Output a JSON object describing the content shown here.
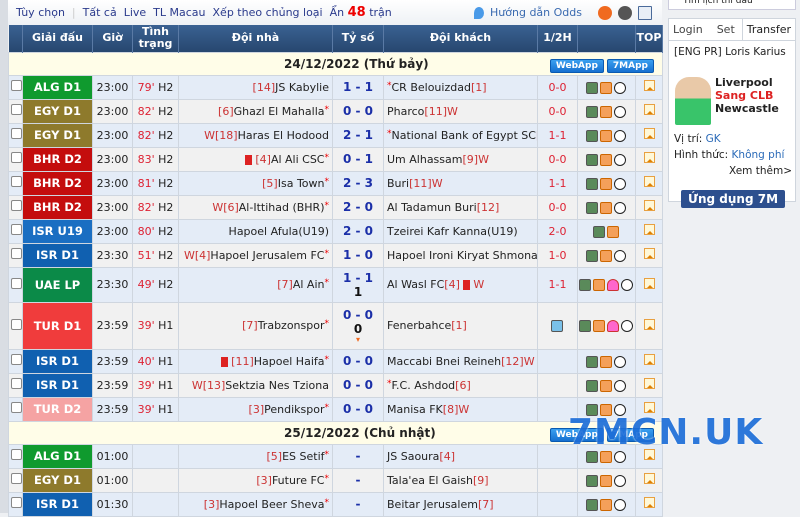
{
  "topbar": {
    "options": "Tùy chọn",
    "all": "Tất cả",
    "live": "Live",
    "tl_macau": "TL Macau",
    "sort": "Xếp theo chủng loại",
    "hide": "Ẩn",
    "hidden_count": "48",
    "matches": "trận",
    "odds_guide": "Hướng dẫn Odds"
  },
  "headers": {
    "league": "Giải đấu",
    "time": "Giờ",
    "status": "Tình trạng",
    "home": "Đội nhà",
    "score": "Tỷ số",
    "away": "Đội khách",
    "half": "1/2H",
    "top": "TOP"
  },
  "apps": {
    "webapp": "WebApp",
    "app7m": "7MApp"
  },
  "sections": [
    {
      "date": "24/12/2022 (Thứ bảy)",
      "rows": [
        {
          "league": "ALG D1",
          "color": "#0f9a2e",
          "time": "23:00",
          "min": "79'",
          "period": "H2",
          "home_rank": "[14]",
          "home": "JS Kabylie",
          "home_star": false,
          "score": "1 - 1",
          "away_star": true,
          "away": "CR Belouizdad",
          "away_rank": "[1]",
          "half": "0-0",
          "icons": 3
        },
        {
          "league": "EGY D1",
          "color": "#8e7a2c",
          "time": "23:00",
          "min": "82'",
          "period": "H2",
          "home_rank": "[6]",
          "home": "Ghazl El Mahalla",
          "home_star": true,
          "score": "0 - 0",
          "away": "Pharco",
          "away_rank": "[11]W",
          "half": "0-0",
          "icons": 3
        },
        {
          "league": "EGY D1",
          "color": "#8e7a2c",
          "time": "23:00",
          "min": "82'",
          "period": "H2",
          "home_rank": "W[18]",
          "home": "Haras El Hodood",
          "score": "2 - 1",
          "away_star": true,
          "away": "National Bank of Egypt SC",
          "away_rank": "[14]",
          "half": "1-1",
          "icons": 3
        },
        {
          "league": "BHR D2",
          "color": "#c40d0d",
          "time": "23:00",
          "min": "83'",
          "period": "H2",
          "home_red": true,
          "home_rank": "[4]",
          "home": "Al Ali CSC",
          "home_star": true,
          "score": "0 - 1",
          "away": "Um Alhassam",
          "away_rank": "[9]W",
          "half": "0-0",
          "icons": 3
        },
        {
          "league": "BHR D2",
          "color": "#c40d0d",
          "time": "23:00",
          "min": "81'",
          "period": "H2",
          "home_rank": "[5]",
          "home": "Isa Town",
          "home_star": true,
          "score": "2 - 3",
          "away": "Buri",
          "away_rank": "[11]W",
          "half": "1-1",
          "icons": 3
        },
        {
          "league": "BHR D2",
          "color": "#c40d0d",
          "time": "23:00",
          "min": "82'",
          "period": "H2",
          "home_rank": "W[6]",
          "home": "Al-Ittihad (BHR)",
          "home_star": true,
          "score": "2 - 0",
          "away": "Al Tadamun Buri",
          "away_rank": "[12]",
          "half": "0-0",
          "icons": 3
        },
        {
          "league": "ISR U19",
          "color": "#1a6ec2",
          "time": "23:00",
          "min": "80'",
          "period": "H2",
          "home_rank": "",
          "home": "Hapoel Afula(U19)",
          "score": "2 - 0",
          "away": "Tzeirei Kafr Kanna(U19)",
          "away_rank": "",
          "half": "2-0",
          "icons": 2
        },
        {
          "league": "ISR D1",
          "color": "#1060b0",
          "time": "23:30",
          "min": "51'",
          "period": "H2",
          "home_rank": "W[4]",
          "home": "Hapoel Jerusalem FC",
          "home_star": true,
          "score": "1 - 0",
          "away": "Hapoel Ironi Kiryat Shmona",
          "away_rank": "[14]",
          "half": "1-0",
          "icons": 3
        },
        {
          "league": "UAE LP",
          "color": "#0b8a48",
          "time": "23:30",
          "min": "49'",
          "period": "H2",
          "home_rank": "[7]",
          "home": "Al Ain",
          "home_star": true,
          "score": "1 - 1",
          "score_extra": "1",
          "away": "Al Wasl FC",
          "away_rank": "[4]",
          "away_red": true,
          "away_suffix": "W",
          "half": "1-1",
          "icons": 4,
          "tall": 35
        },
        {
          "league": "TUR D1",
          "color": "#f03c3c",
          "time": "23:59",
          "min": "39'",
          "period": "H1",
          "home_rank": "[7]",
          "home": "Trabzonspor",
          "home_star": true,
          "score": "0 - 0",
          "score_extra": "0",
          "score_arrow": true,
          "away": "Fenerbahce",
          "away_rank": "[1]",
          "half": "",
          "half_icon": true,
          "icons": 4,
          "tall": 47
        },
        {
          "league": "ISR D1",
          "color": "#1060b0",
          "time": "23:59",
          "min": "40'",
          "period": "H1",
          "home_red": true,
          "home_rank": "[11]",
          "home": "Hapoel Haifa",
          "home_star": true,
          "score": "0 - 0",
          "away": "Maccabi Bnei Reineh",
          "away_rank": "[12]W",
          "half": "",
          "icons": 3
        },
        {
          "league": "ISR D1",
          "color": "#1060b0",
          "time": "23:59",
          "min": "39'",
          "period": "H1",
          "home_rank": "W[13]",
          "home": "Sektzia Nes Tziona",
          "score": "0 - 0",
          "away_star": true,
          "away": "F.C. Ashdod",
          "away_rank": "[6]",
          "half": "",
          "icons": 3
        },
        {
          "league": "TUR D2",
          "color": "#f5a3a3",
          "time": "23:59",
          "min": "39'",
          "period": "H1",
          "home_rank": "[3]",
          "home": "Pendikspor",
          "home_star": true,
          "score": "0 - 0",
          "away": "Manisa FK",
          "away_rank": "[8]W",
          "half": "",
          "icons": 3
        }
      ]
    },
    {
      "date": "25/12/2022 (Chủ nhật)",
      "rows": [
        {
          "league": "ALG D1",
          "color": "#0f9a2e",
          "time": "01:00",
          "min": "",
          "period": "",
          "home_rank": "[5]",
          "home": "ES Setif",
          "home_star": true,
          "score": "-",
          "away": "JS Saoura",
          "away_rank": "[4]",
          "half": "",
          "icons": 3
        },
        {
          "league": "EGY D1",
          "color": "#8e7a2c",
          "time": "01:00",
          "min": "",
          "period": "",
          "home_rank": "[3]",
          "home": "Future FC",
          "home_star": true,
          "score": "-",
          "away": "Tala'ea El Gaish",
          "away_rank": "[9]",
          "half": "",
          "icons": 3
        },
        {
          "league": "ISR D1",
          "color": "#1060b0",
          "time": "01:30",
          "min": "",
          "period": "",
          "home_rank": "[3]",
          "home": "Hapoel Beer Sheva",
          "home_star": true,
          "score": "-",
          "away": "Beitar Jerusalem",
          "away_rank": "[7]",
          "half": "",
          "icons": 3
        }
      ]
    }
  ],
  "sidebar": {
    "find": "Tìm lịch thi đấu",
    "tabs": [
      "Login",
      "Set",
      "Transfer"
    ],
    "transfer": {
      "headline": "[ENG PR] Loris Karius",
      "from": "Liverpool",
      "action": "Sang CLB",
      "to": "Newcastle",
      "position_label": "Vị trí:",
      "position": "GK",
      "type_label": "Hình thức:",
      "type": "Không phí",
      "more": "Xem thêm>"
    },
    "app_button": "Ứng dụng 7M"
  },
  "watermark": "7MCN.UK"
}
